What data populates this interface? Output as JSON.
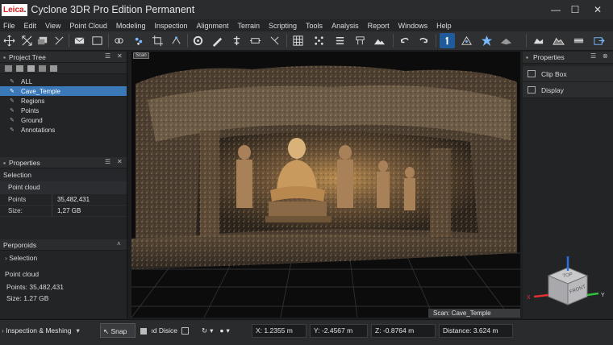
{
  "window": {
    "logo_main": "Leica",
    "logo_dot": ".",
    "title": "Cyclone 3DR Pro Edition Permanent",
    "minimize": "—",
    "maximize": "☐",
    "close": "✕"
  },
  "menu": [
    "File",
    "Edit",
    "View",
    "Point Cloud",
    "Modeling",
    "Inspection",
    "Alignment",
    "Terrain",
    "Scripting",
    "Tools",
    "Analysis",
    "Report",
    "Windows",
    "Help"
  ],
  "project_tree": {
    "title": "Project Tree",
    "items": [
      {
        "label": "ALL",
        "selected": false
      },
      {
        "label": "Cave_Temple",
        "selected": true
      },
      {
        "label": "Regions",
        "selected": false
      },
      {
        "label": "Points",
        "selected": false
      },
      {
        "label": "Ground",
        "selected": false
      },
      {
        "label": "Annotations",
        "selected": false
      }
    ]
  },
  "properties_left": {
    "title": "Properties",
    "section": "Selection",
    "object": "Point cloud",
    "rows": [
      {
        "key": "Points",
        "value": "35,482,431"
      },
      {
        "key": "Size:",
        "value": "1,27 GB"
      }
    ]
  },
  "perporoids": {
    "title": "Perporoids",
    "selection": "Selection",
    "object": "Point cloud",
    "points_label": "Points:",
    "points_value": "35,482,431",
    "size_label": "Size:",
    "size_value": "1.27 GB"
  },
  "viewport": {
    "tab_label": "Scan",
    "status": "Scan: Cave_Temple",
    "cube_top": "TOP",
    "cube_front": "FRONT",
    "axis_x": "X",
    "axis_y": "Y",
    "axis_z": "Z"
  },
  "right_panel": {
    "title": "Properties",
    "items": [
      "Clip Box",
      "Display"
    ]
  },
  "statusbar": {
    "mode": "Inspection & Meshing",
    "snap": "Snap",
    "display_mode": "Disice",
    "x_label": "X:",
    "x_value": "1.2355 m",
    "y_label": "Y:",
    "y_value": "-2.4567 m",
    "z_label": "Z:",
    "z_value": "-0.8764 m",
    "distance_label": "Distance:",
    "distance_value": "3.624 m"
  },
  "colors": {
    "accent": "#3a78b8",
    "background": "#1e1f21",
    "panel": "#232426"
  }
}
